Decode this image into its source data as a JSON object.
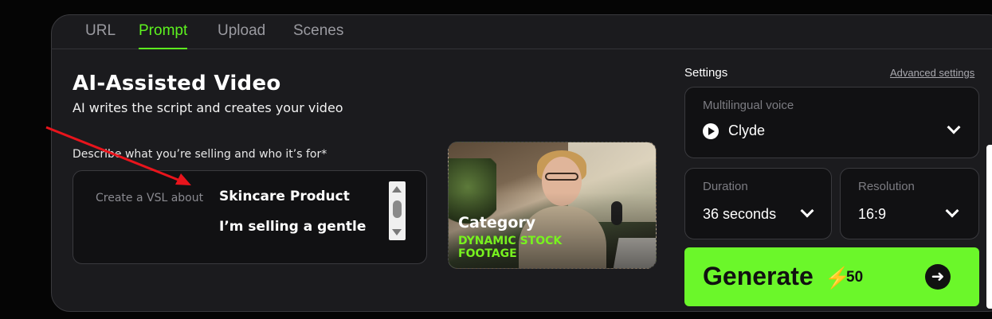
{
  "tabs": [
    {
      "label": "URL",
      "active": false
    },
    {
      "label": "Prompt",
      "active": true
    },
    {
      "label": "Upload",
      "active": false
    },
    {
      "label": "Scenes",
      "active": false
    }
  ],
  "hero": {
    "title": "AI-Assisted Video",
    "subtitle": "AI writes the script and creates your video"
  },
  "prompt": {
    "field_label": "Describe what you’re selling and who it’s for*",
    "prefix": "Create a VSL about",
    "lines": [
      "Skincare Product",
      "I’m selling a gentle"
    ]
  },
  "category": {
    "label": "Category",
    "value": "DYNAMIC STOCK FOOTAGE"
  },
  "settings": {
    "label": "Settings",
    "advanced_link": "Advanced settings",
    "voice": {
      "label": "Multilingual voice",
      "value": "Clyde",
      "icon": "play-icon"
    },
    "duration": {
      "label": "Duration",
      "value": "36 seconds"
    },
    "resolution": {
      "label": "Resolution",
      "value": "16:9"
    }
  },
  "generate": {
    "label": "Generate",
    "cost_icon": "bolt-icon",
    "cost": "50",
    "arrow_icon": "arrow-right-icon"
  },
  "colors": {
    "accent": "#6bf72a",
    "tab_active": "#5df21f",
    "annotation_arrow": "#e8141c"
  }
}
